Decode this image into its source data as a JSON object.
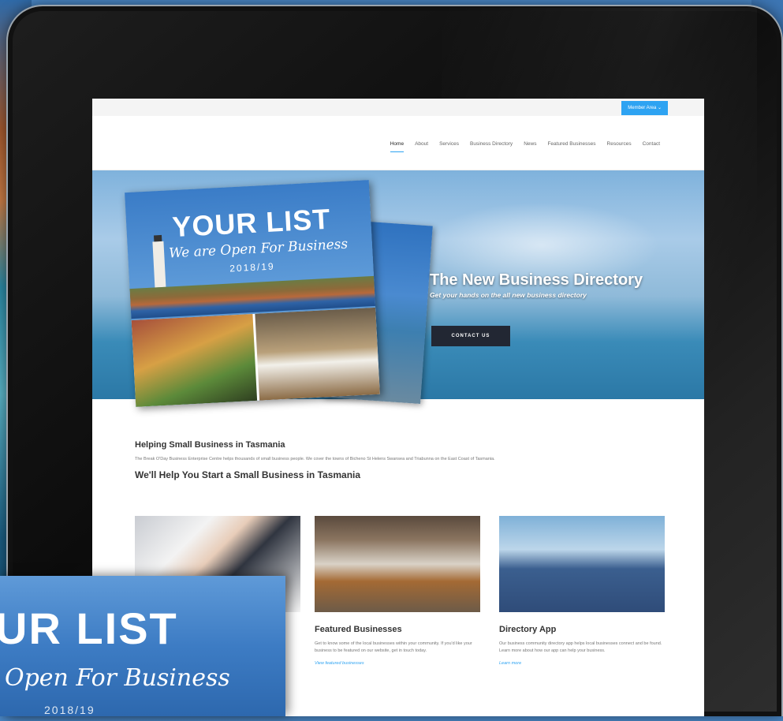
{
  "topbar": {
    "member_area": "Member Area ⌄"
  },
  "nav": {
    "items": [
      "Home",
      "About",
      "Services",
      "Business Directory",
      "News",
      "Featured Businesses",
      "Resources",
      "Contact"
    ],
    "active": "Home"
  },
  "hero": {
    "brochure_title": "YOUR LIST",
    "brochure_subtitle": "We are Open For Business",
    "brochure_year": "2018/19",
    "title": "The New Business Directory",
    "subtitle": "Get your hands on the all new business directory",
    "cta": "CONTACT US"
  },
  "intro": {
    "heading": "Helping Small Business in Tasmania",
    "text": "The Break O'Day Business Enterprise Centre helps thousands of small business people. We cover the towns of Bicheno St Helens Swansea and Triabunna on the East Coast of Tasmania.",
    "subheading": "We'll Help You Start a Small Business in Tasmania"
  },
  "cards": [
    {
      "title": "",
      "text": "",
      "link": ""
    },
    {
      "title": "Featured Businesses",
      "text": "Get to know some of the local businesses within your community. If you'd like your business to be featured on our website, get in touch today.",
      "link": "View featured businesses"
    },
    {
      "title": "Directory App",
      "text": "Our business community directory app helps local businesses connect and be found. Learn more about how our app can help your business.",
      "link": "Learn more"
    }
  ],
  "overlay": {
    "title": "UR LIST",
    "subtitle": "Open For Business",
    "year": "2018/19"
  }
}
